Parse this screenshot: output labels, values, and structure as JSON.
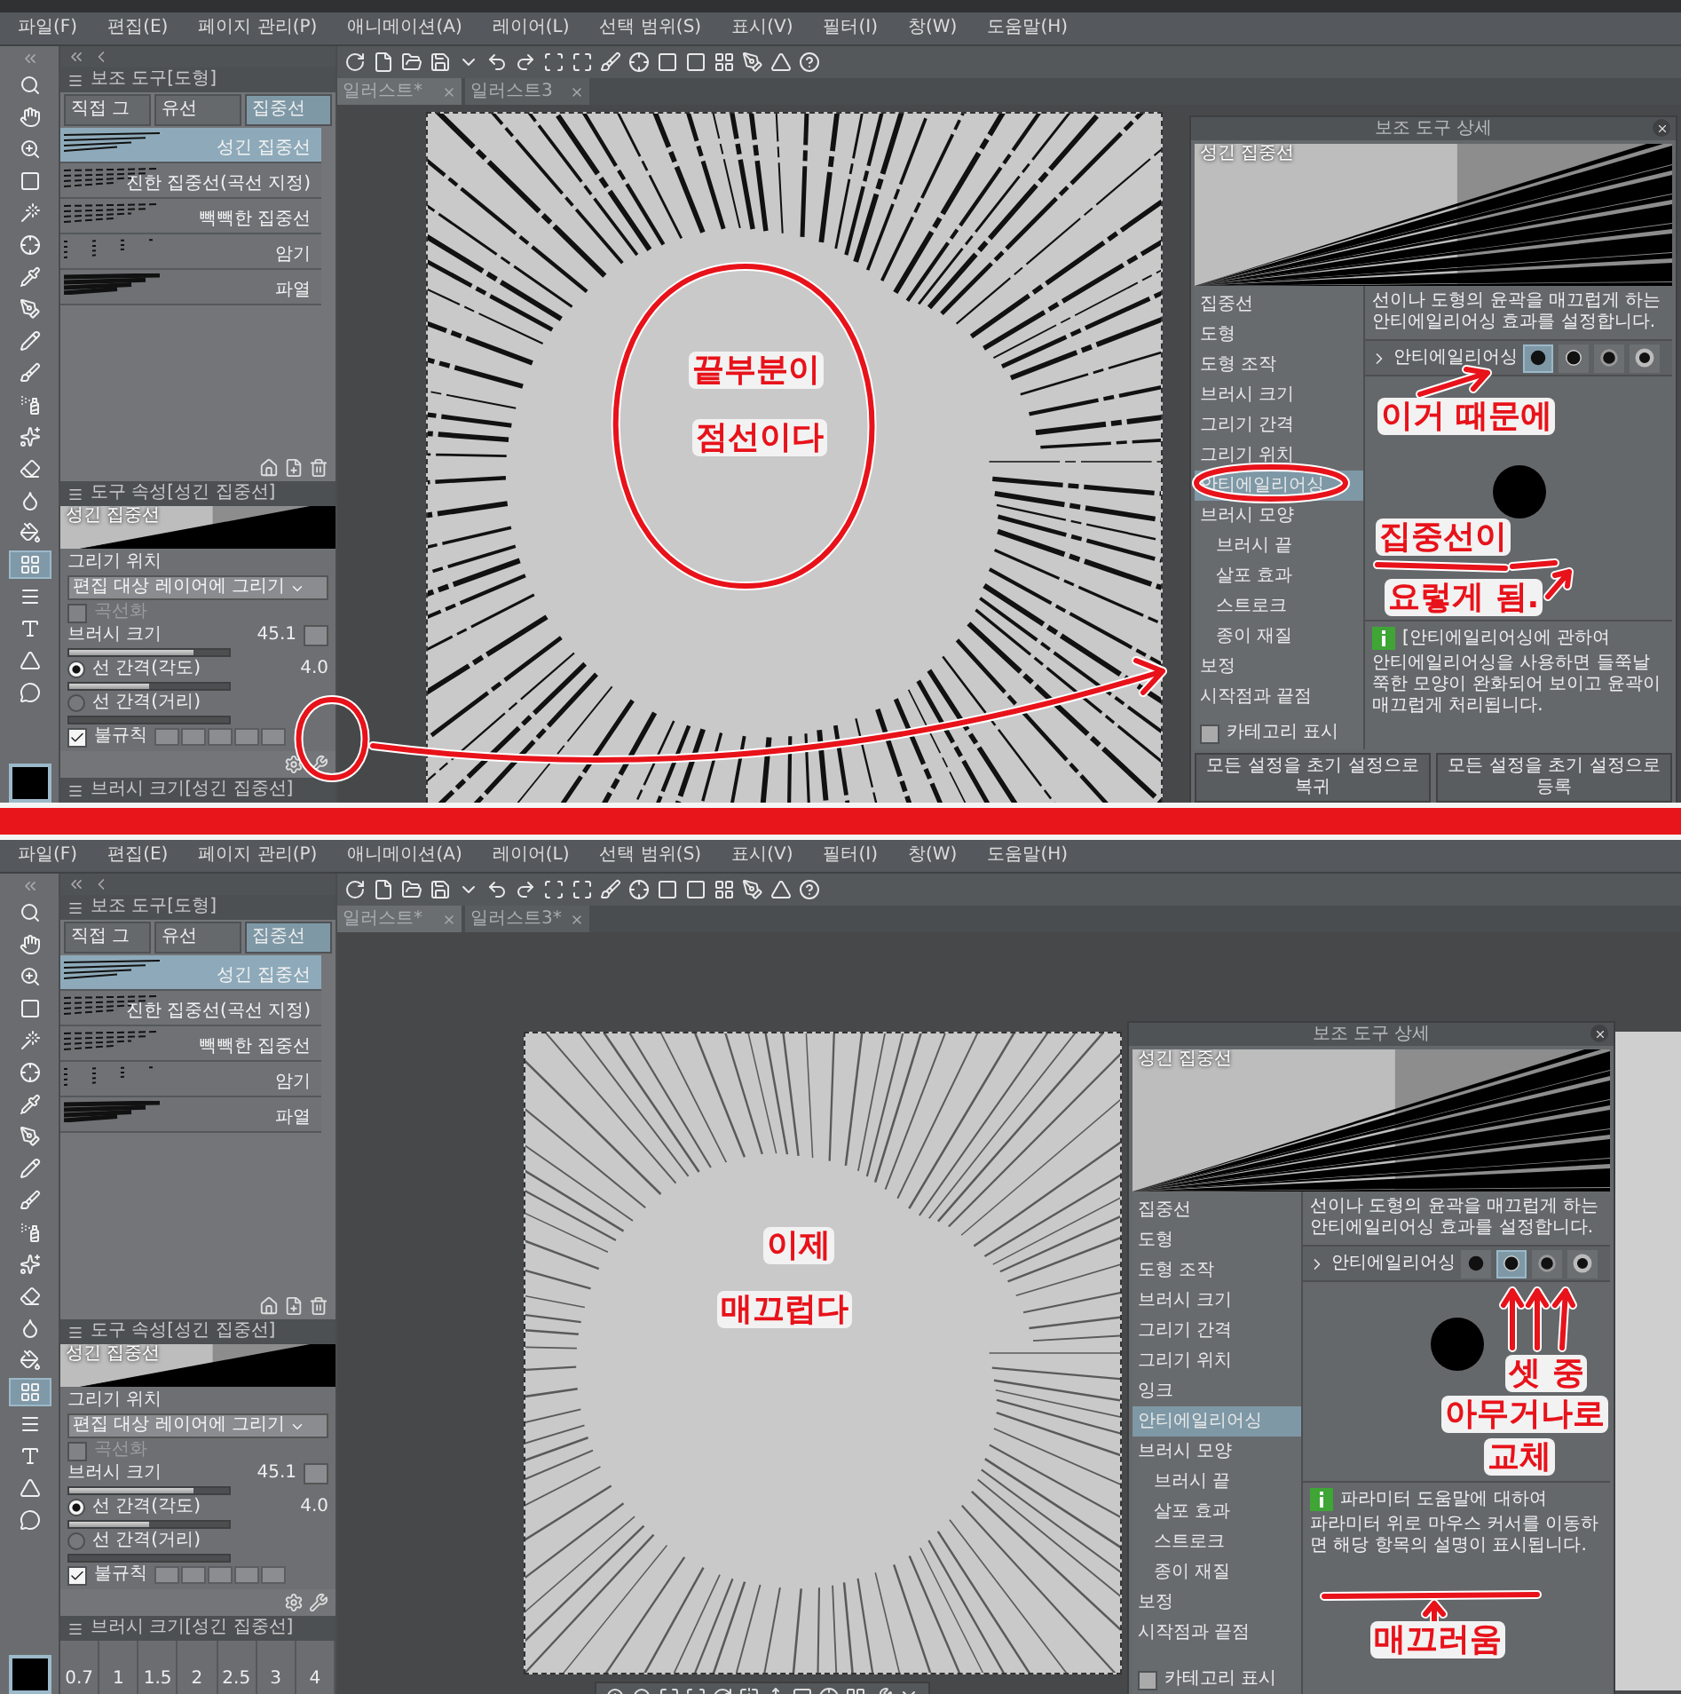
{
  "screens": [
    {
      "menu": [
        "파일(F)",
        "편집(E)",
        "페이지 관리(P)",
        "애니메이션(A)",
        "레이어(L)",
        "선택 범위(S)",
        "표시(V)",
        "필터(I)",
        "창(W)",
        "도움말(H)"
      ],
      "doc_tabs": [
        {
          "label": "일러스트*",
          "selected": true
        },
        {
          "label": "일러스트3",
          "selected": false
        }
      ],
      "subtool_panel": {
        "title": "보조 도구[도형]",
        "groups": [
          {
            "label": "직접 그",
            "selected": false
          },
          {
            "label": "유선",
            "selected": false
          },
          {
            "label": "집중선",
            "selected": true
          }
        ],
        "items": [
          {
            "label": "성긴 집중선",
            "selected": true
          },
          {
            "label": "진한 집중선(곡선 지정)",
            "selected": false
          },
          {
            "label": "빽빽한 집중선",
            "selected": false
          },
          {
            "label": "암기",
            "selected": false
          },
          {
            "label": "파열",
            "selected": false
          }
        ]
      },
      "tool_property": {
        "title": "도구 속성[성긴 집중선]",
        "preview_label": "성긴 집중선",
        "draw_target": {
          "label": "그리기 위치",
          "value": "편집 대상 레이어에 그리기"
        },
        "curve": {
          "label": "곡선화",
          "checked": false,
          "disabled": true
        },
        "brush_size": {
          "label": "브러시 크기",
          "value": "45.1",
          "level": 0.78
        },
        "spacing_angle": {
          "label": "선 간격(각도)",
          "value": "4.0",
          "selected": true,
          "level": 0.5
        },
        "spacing_distance": {
          "label": "선 간격(거리)",
          "selected": false,
          "level": 0
        },
        "irregular": {
          "label": "불규칙",
          "checked": true
        }
      },
      "brush_size_panel": {
        "title": "브러시 크기[성긴 집중선]"
      },
      "detail_dialog": {
        "title": "보조 도구 상세",
        "preview_label": "성긴 집중선",
        "categories": [
          {
            "label": "집중선",
            "selected": false
          },
          {
            "label": "도형",
            "selected": false
          },
          {
            "label": "도형 조작",
            "selected": false
          },
          {
            "label": "브러시 크기",
            "selected": false
          },
          {
            "label": "그리기 간격",
            "selected": false
          },
          {
            "label": "그리기 위치",
            "selected": false
          },
          {
            "label": "안티에일리어싱",
            "selected": true
          },
          {
            "label": "브러시 모양",
            "selected": false,
            "children": [
              {
                "label": "브러시 끝",
                "selected": false
              },
              {
                "label": "살포 효과",
                "selected": false
              },
              {
                "label": "스트로크",
                "selected": false
              },
              {
                "label": "종이 재질",
                "selected": false
              }
            ]
          },
          {
            "label": "보정",
            "selected": false
          },
          {
            "label": "시작점과 끝점",
            "selected": false
          }
        ],
        "description": "선이나 도형의 윤곽을 매끄럽게 하는 안티에일리어싱 효과를 설정합니다.",
        "setting": {
          "label": "안티에일리어싱",
          "options": [
            {
              "selected": true
            },
            {
              "selected": false
            },
            {
              "selected": false
            },
            {
              "selected": false
            }
          ]
        },
        "help": {
          "title": "[안티에일리어싱에 관하여",
          "body": "안티에일리어싱을 사용하면 들쭉날쭉한 모양이 완화되어 보이고 윤곽이 매끄럽게 처리됩니다."
        },
        "show_category": {
          "label": "카테고리 표시",
          "checked": false
        },
        "buttons": [
          "모든 설정을 초기 설정으로 복귀",
          "모든 설정을 초기 설정으로 등록"
        ]
      },
      "annotations": [
        "끝부분이",
        "점선이다",
        "이거 때문에",
        "집중선이",
        "요렇게 됨."
      ]
    },
    {
      "menu": [
        "파일(F)",
        "편집(E)",
        "페이지 관리(P)",
        "애니메이션(A)",
        "레이어(L)",
        "선택 범위(S)",
        "표시(V)",
        "필터(I)",
        "창(W)",
        "도움말(H)"
      ],
      "doc_tabs": [
        {
          "label": "일러스트*",
          "selected": true
        },
        {
          "label": "일러스트3*",
          "selected": false
        }
      ],
      "subtool_panel": {
        "title": "보조 도구[도형]",
        "groups": [
          {
            "label": "직접 그",
            "selected": false
          },
          {
            "label": "유선",
            "selected": false
          },
          {
            "label": "집중선",
            "selected": true
          }
        ],
        "items": [
          {
            "label": "성긴 집중선",
            "selected": true
          },
          {
            "label": "진한 집중선(곡선 지정)",
            "selected": false
          },
          {
            "label": "빽빽한 집중선",
            "selected": false
          },
          {
            "label": "암기",
            "selected": false
          },
          {
            "label": "파열",
            "selected": false
          }
        ]
      },
      "tool_property": {
        "title": "도구 속성[성긴 집중선]",
        "preview_label": "성긴 집중선",
        "draw_target": {
          "label": "그리기 위치",
          "value": "편집 대상 레이어에 그리기"
        },
        "curve": {
          "label": "곡선화",
          "checked": false,
          "disabled": true
        },
        "brush_size": {
          "label": "브러시 크기",
          "value": "45.1",
          "level": 0.78
        },
        "spacing_angle": {
          "label": "선 간격(각도)",
          "value": "4.0",
          "selected": true,
          "level": 0.5
        },
        "spacing_distance": {
          "label": "선 간격(거리)",
          "selected": false,
          "level": 0
        },
        "irregular": {
          "label": "불규칙",
          "checked": true
        }
      },
      "brush_size_panel": {
        "title": "브러시 크기[성긴 집중선]",
        "sizes": [
          "0.7",
          "1",
          "1.5",
          "2",
          "2.5",
          "3",
          "4"
        ]
      },
      "canvas": {
        "toolbar": true
      },
      "detail_dialog": {
        "title": "보조 도구 상세",
        "preview_label": "성긴 집중선",
        "categories": [
          {
            "label": "집중선",
            "selected": false
          },
          {
            "label": "도형",
            "selected": false
          },
          {
            "label": "도형 조작",
            "selected": false
          },
          {
            "label": "브러시 크기",
            "selected": false
          },
          {
            "label": "그리기 간격",
            "selected": false
          },
          {
            "label": "그리기 위치",
            "selected": false
          },
          {
            "label": "잉크",
            "selected": false
          },
          {
            "label": "안티에일리어싱",
            "selected": true
          },
          {
            "label": "브러시 모양",
            "selected": false,
            "children": [
              {
                "label": "브러시 끝",
                "selected": false
              },
              {
                "label": "살포 효과",
                "selected": false
              },
              {
                "label": "스트로크",
                "selected": false
              },
              {
                "label": "종이 재질",
                "selected": false
              }
            ]
          },
          {
            "label": "보정",
            "selected": false
          },
          {
            "label": "시작점과 끝점",
            "selected": false
          }
        ],
        "description": "선이나 도형의 윤곽을 매끄럽게 하는 안티에일리어싱 효과를 설정합니다.",
        "setting": {
          "label": "안티에일리어싱",
          "options": [
            {
              "selected": false
            },
            {
              "selected": true
            },
            {
              "selected": false
            },
            {
              "selected": false
            }
          ]
        },
        "help": {
          "title": "파라미터 도움말에 대하여",
          "body": "파라미터 위로 마우스 커서를 이동하면 해당 항목의 설명이 표시됩니다."
        },
        "show_category": {
          "label": "카테고리 표시",
          "checked": false
        }
      },
      "annotations": [
        "이제",
        "매끄럽다",
        "셋 중",
        "아무거나로",
        "교체",
        "매끄러움"
      ]
    }
  ]
}
